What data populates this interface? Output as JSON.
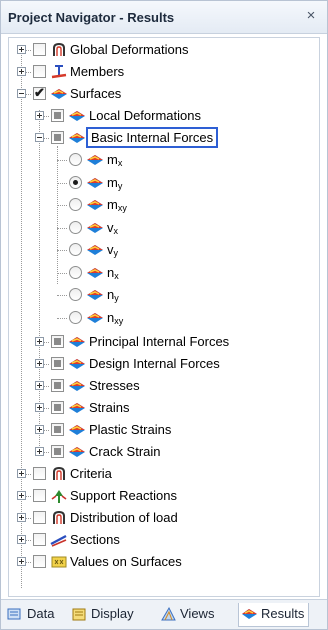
{
  "title": "Project Navigator - Results",
  "close_glyph": "×",
  "tree": {
    "global_deformations": "Global Deformations",
    "members": "Members",
    "surfaces": "Surfaces",
    "local_deformations": "Local Deformations",
    "basic_internal_forces": "Basic Internal Forces",
    "radio_items": [
      {
        "base": "m",
        "sub": "x",
        "selected": false
      },
      {
        "base": "m",
        "sub": "y",
        "selected": true
      },
      {
        "base": "m",
        "sub": "xy",
        "selected": false
      },
      {
        "base": "v",
        "sub": "x",
        "selected": false
      },
      {
        "base": "v",
        "sub": "y",
        "selected": false
      },
      {
        "base": "n",
        "sub": "x",
        "selected": false
      },
      {
        "base": "n",
        "sub": "y",
        "selected": false
      },
      {
        "base": "n",
        "sub": "xy",
        "selected": false
      }
    ],
    "principal_internal_forces": "Principal Internal Forces",
    "design_internal_forces": "Design Internal Forces",
    "stresses": "Stresses",
    "strains": "Strains",
    "plastic_strains": "Plastic Strains",
    "crack_strain": "Crack Strain",
    "criteria": "Criteria",
    "support_reactions": "Support Reactions",
    "distribution_of_load": "Distribution of load",
    "sections": "Sections",
    "values_on_surfaces": "Values on Surfaces"
  },
  "tabs": {
    "data": "Data",
    "display": "Display",
    "views": "Views",
    "results": "Results",
    "active": "results"
  },
  "colors": {
    "selection_outline": "#2e5fd4",
    "surface_icon_top": "#e03a2a",
    "surface_icon_bottom": "#1f7fd8"
  }
}
